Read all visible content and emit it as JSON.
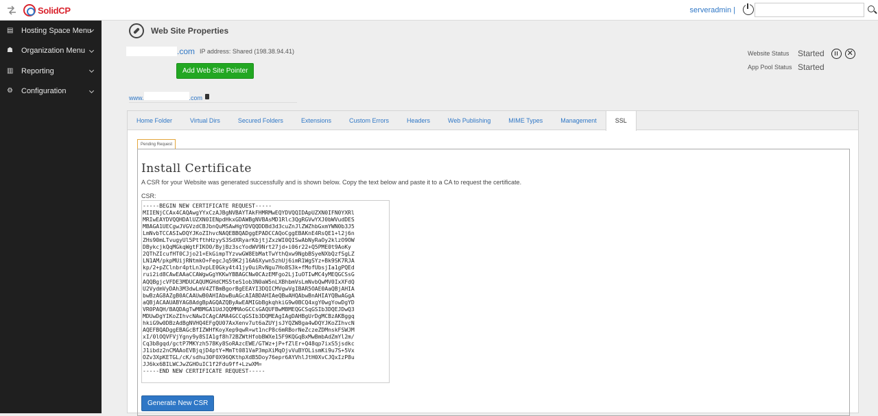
{
  "topbar": {
    "brand": "SolidCP",
    "username": "serveradmin",
    "separator": "|",
    "search_value": ""
  },
  "sidebar": {
    "items": [
      {
        "label": "Hosting Space Menu",
        "icon": "server-icon"
      },
      {
        "label": "Organization Menu",
        "icon": "users-icon"
      },
      {
        "label": "Reporting",
        "icon": "chart-icon"
      },
      {
        "label": "Configuration",
        "icon": "gears-icon"
      }
    ]
  },
  "page": {
    "title": "Web Site Properties",
    "domain_suffix": ".com",
    "ip_label": "IP address: Shared (198.38.94.41)",
    "add_pointer_label": "Add Web Site Pointer",
    "pointer_prefix": "www.",
    "pointer_suffix": ".com",
    "status": {
      "website_label": "Website Status",
      "website_value": "Started",
      "apppool_label": "App Pool Status",
      "apppool_value": "Started"
    }
  },
  "tabs": [
    "Home Folder",
    "Virtual Dirs",
    "Secured Folders",
    "Extensions",
    "Custom Errors",
    "Headers",
    "Web Publishing",
    "MIME Types",
    "Management",
    "SSL"
  ],
  "active_tab": "SSL",
  "ssl": {
    "pending_tab": "Pending Request",
    "title": "Install Certificate",
    "description": "A CSR for your Website was generated successfully and is shown below. Copy the text below and paste it to a CA to request the certificate.",
    "csr_label": "CSR:",
    "csr_text": "-----BEGIN NEW CERTIFICATE REQUEST-----\nMIIENjCCAx4CAQAwgYYxCzAJBgNVBAYTAkFHMRMwEQYDVQQIDApUZXN0IFN0YXRl\nMRIwEAYDVQQHDAlUZXN0IENpdHkxGDAWBgNVBAsMD1Rlc3QgRGVwYXJ0bWVudDES\nMBAGA1UECgwJVGVzdCBJbnQuMSAwHgYDVQQDDBd3d3cuZnJlZWZhbGxmYWN0b3J5\nLmNvbTCCASIwDQYJKoZIhvcNAQEBBQADggEPADCCAQoCggEBAKnE4RsQE1+l2j6n\nZHs90mLTvugyUl5PtfthHzyyS3SdXRyarKbjtjZxzWI0QISwAbNyRaOy2klzO9OW\nDBykcjkQqMGkqWgtFIKO0/ByjBz3scYodWV9Nrt27jd+i06r22+Q5PME0t9AoKy\n2QThZIcufHT0CJjo21+EkGimpTYzvwGW8EbMatTwYthQxw9NgbBSyeNXbQzfSgLZ\nLN1AM/pkpMUijRNtmkO+FegcJq59K2j16A6Xywn5zhUj6imR1WgSYz+Bk9SK7RJA\nkp/2+pZClnbr4ptLn3vpLE0Gky4t41jy0uiRvNgu7Ho8S3k+fMofUbsjIa1gPQEd\nrui2id8CAwEAAaCCAWgwGgYKKwYBBAGCNw0CAzEMFgo2LjIuOTIwMC4yMEQGCSsG\nAQQBgjcVFDE3MDUCAQUMGHdCMS5teS1ob3N0aW5nLXBhbmVsLmNvbQwMV0IxXFdQ\nU2VydmVyDAh3M3dwLmV4ZTBmBgorBgEEAYI3DQICMVgwVgIBAR5OAE0AaQBjAHIA\nbwBzAG8AZgB0ACAAUwB0AHIAbwBuAGcAIABDAHIAeQBwAHQAbwBnAHIAYQBwAGgA\naQBjACAAUABYAG8AdgBpAGQAZQByAwEAMIGbBgkqhkiG9w0BCQ4xgY0wgYowDgYD\nVR0PAQH/BAQDAgTwMBMGA1UdJQQMMAoGCCsGAQUFBwMBMEQGCSqGSIb3DQEJDwQ3\nMDUwDgYIKoZIhvcNAwICAgCAMA4GCCqGSIb3DQMEAgIAgDAHBgUrDgMCBzAKBggq\nhkiG9w0DBzAdBgNVHQ4EFgQU07AxXenv7ut6aZUYjsJYQZW8ga4wDQYJKoZIhvcN\nAQEFBQADggEBAGcBfIZWHfKoyXep9qwR+wt1ncP8c6mRBorNeZczeZDMnskFSWJM\nxI/0lOQVFVjYgny9y8SIA1gf8h72BZWtHfobBWXe15F9KQGqBxMwBmbAdZmYl2m/\nCq3b8gqd/gctP7MKYzh578Ky8SoRAzcEWE/GTWz+jP+fZlEr+Q48qp7ixS5jsdkc\nJ1ibdz2nCMAAoEVBjqjD4ptY+MmTt081VaP3mpXiMqOjvVuBYOLismKi9u7S+5Vx\nOZv3XpKETGL/cK/sdhu30F0X96QKthpXdB5Doy76epr6AYVhlJtH0XvCJQxIzP8u\nJJ6kx6BILWCJwZGHOuIC1f2Fdu9ff+LzwXM=\n-----END NEW CERTIFICATE REQUEST-----",
    "generate_label": "Generate New CSR"
  },
  "colors": {
    "accent": "#2f77c6",
    "success": "#22a722",
    "sidebar": "#1f1f1f",
    "brand_red": "#d9232d"
  }
}
